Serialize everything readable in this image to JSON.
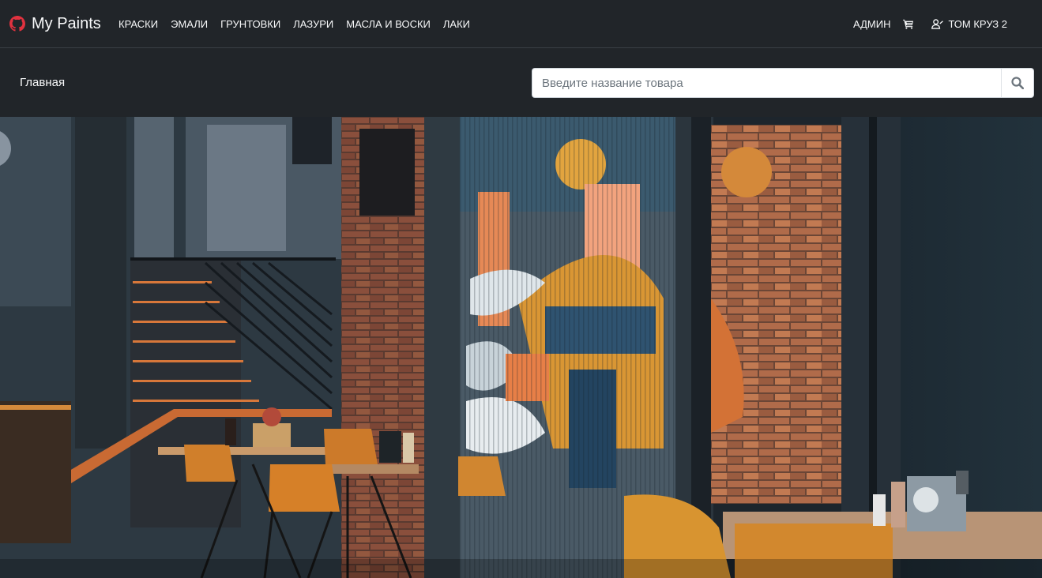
{
  "brand": {
    "name": "My Paints",
    "icon": "github-icon"
  },
  "nav": {
    "items": [
      {
        "label": "КРАСКИ"
      },
      {
        "label": "ЭМАЛИ"
      },
      {
        "label": "ГРУНТОВКИ"
      },
      {
        "label": "ЛАЗУРИ"
      },
      {
        "label": "МАСЛА И ВОСКИ"
      },
      {
        "label": "ЛАКИ"
      }
    ],
    "admin_label": "АДМИН",
    "cart_icon": "cart-icon",
    "user_label": "ТОМ КРУЗ 2",
    "user_icon": "user-icon"
  },
  "breadcrumb": {
    "home": "Главная"
  },
  "search": {
    "placeholder": "Введите название товара",
    "value": "",
    "icon": "search-icon"
  },
  "colors": {
    "navbar_bg": "#212529",
    "brand_icon": "#e0323f",
    "text": "#f8f9fa"
  },
  "hero": {
    "image": "cafe-interior-photo"
  }
}
